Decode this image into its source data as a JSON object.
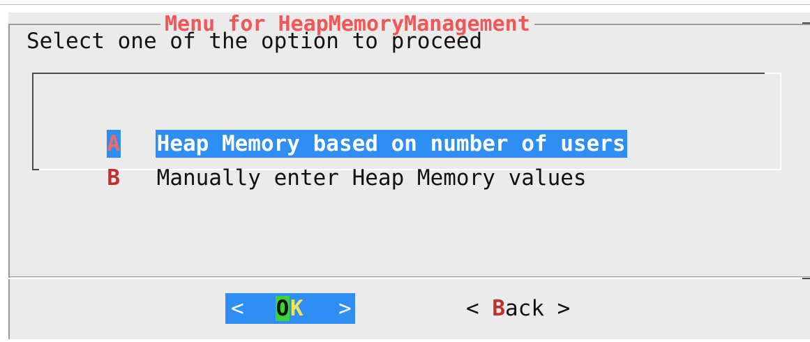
{
  "dialog": {
    "title": "Menu for HeapMemoryManagement",
    "prompt": "Select one of the option to proceed"
  },
  "menu": {
    "items": [
      {
        "tag": "A",
        "label": "Heap Memory based on number of users",
        "selected": true
      },
      {
        "tag": "B",
        "label": "Manually enter Heap Memory values",
        "selected": false
      }
    ]
  },
  "buttons": {
    "ok": {
      "open": "<",
      "hotkey": "O",
      "rest": "K",
      "close": ">"
    },
    "back": {
      "open": "< ",
      "hotkey": "B",
      "rest": "ack",
      "close": " >"
    }
  },
  "colors": {
    "title": "#f25757",
    "selection": "#2e8ef3",
    "hotkey": "#c0302f",
    "ok_hotkey_bg": "#3ad43a",
    "ok_rest": "#f4e64a",
    "dialog_bg": "#ebebeb"
  }
}
